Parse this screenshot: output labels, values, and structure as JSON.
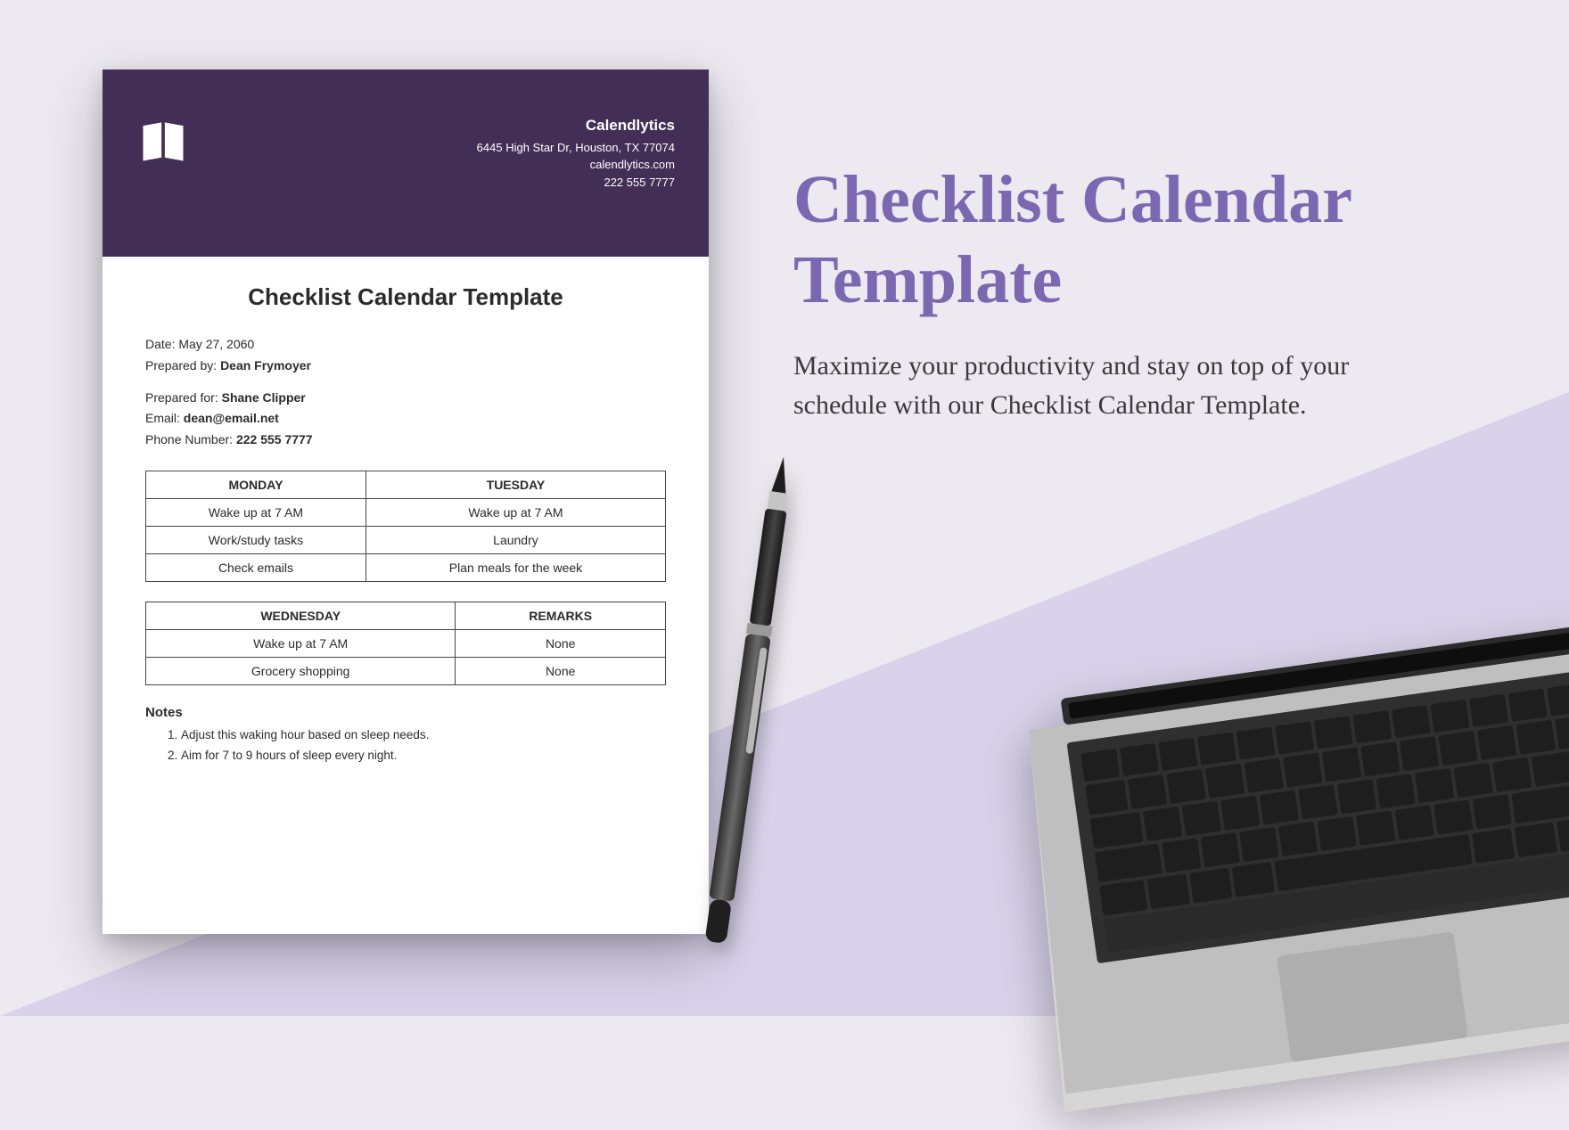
{
  "promo": {
    "title": "Checklist Calendar Template",
    "description": "Maximize your productivity and stay on top of your schedule with our Checklist Calendar Template."
  },
  "doc": {
    "org": {
      "name": "Calendlytics",
      "address": "6445 High Star Dr, Houston, TX 77074",
      "website": "calendlytics.com",
      "phone": "222 555 7777"
    },
    "title": "Checklist Calendar Template",
    "meta1": {
      "date_label": "Date:",
      "date_value": "May 27, 2060",
      "prep_by_label": "Prepared by:",
      "prep_by_value": "Dean Frymoyer"
    },
    "meta2": {
      "prep_for_label": "Prepared for:",
      "prep_for_value": "Shane Clipper",
      "email_label": "Email:",
      "email_value": "dean@email.net",
      "phone_label": "Phone Number:",
      "phone_value": "222 555 7777"
    },
    "table1": {
      "col1_header": "MONDAY",
      "col2_header": "TUESDAY",
      "rows": [
        {
          "c1": "Wake up at 7 AM",
          "c2": "Wake up at 7 AM"
        },
        {
          "c1": "Work/study tasks",
          "c2": "Laundry"
        },
        {
          "c1": "Check emails",
          "c2": "Plan meals for the week"
        }
      ]
    },
    "table2": {
      "col1_header": "WEDNESDAY",
      "col2_header": "REMARKS",
      "rows": [
        {
          "c1": "Wake up at 7 AM",
          "c2": "None"
        },
        {
          "c1": "Grocery shopping",
          "c2": "None"
        }
      ]
    },
    "notes_heading": "Notes",
    "notes": [
      "Adjust this waking hour based on sleep needs.",
      "Aim for 7 to 9 hours of sleep every night."
    ]
  }
}
